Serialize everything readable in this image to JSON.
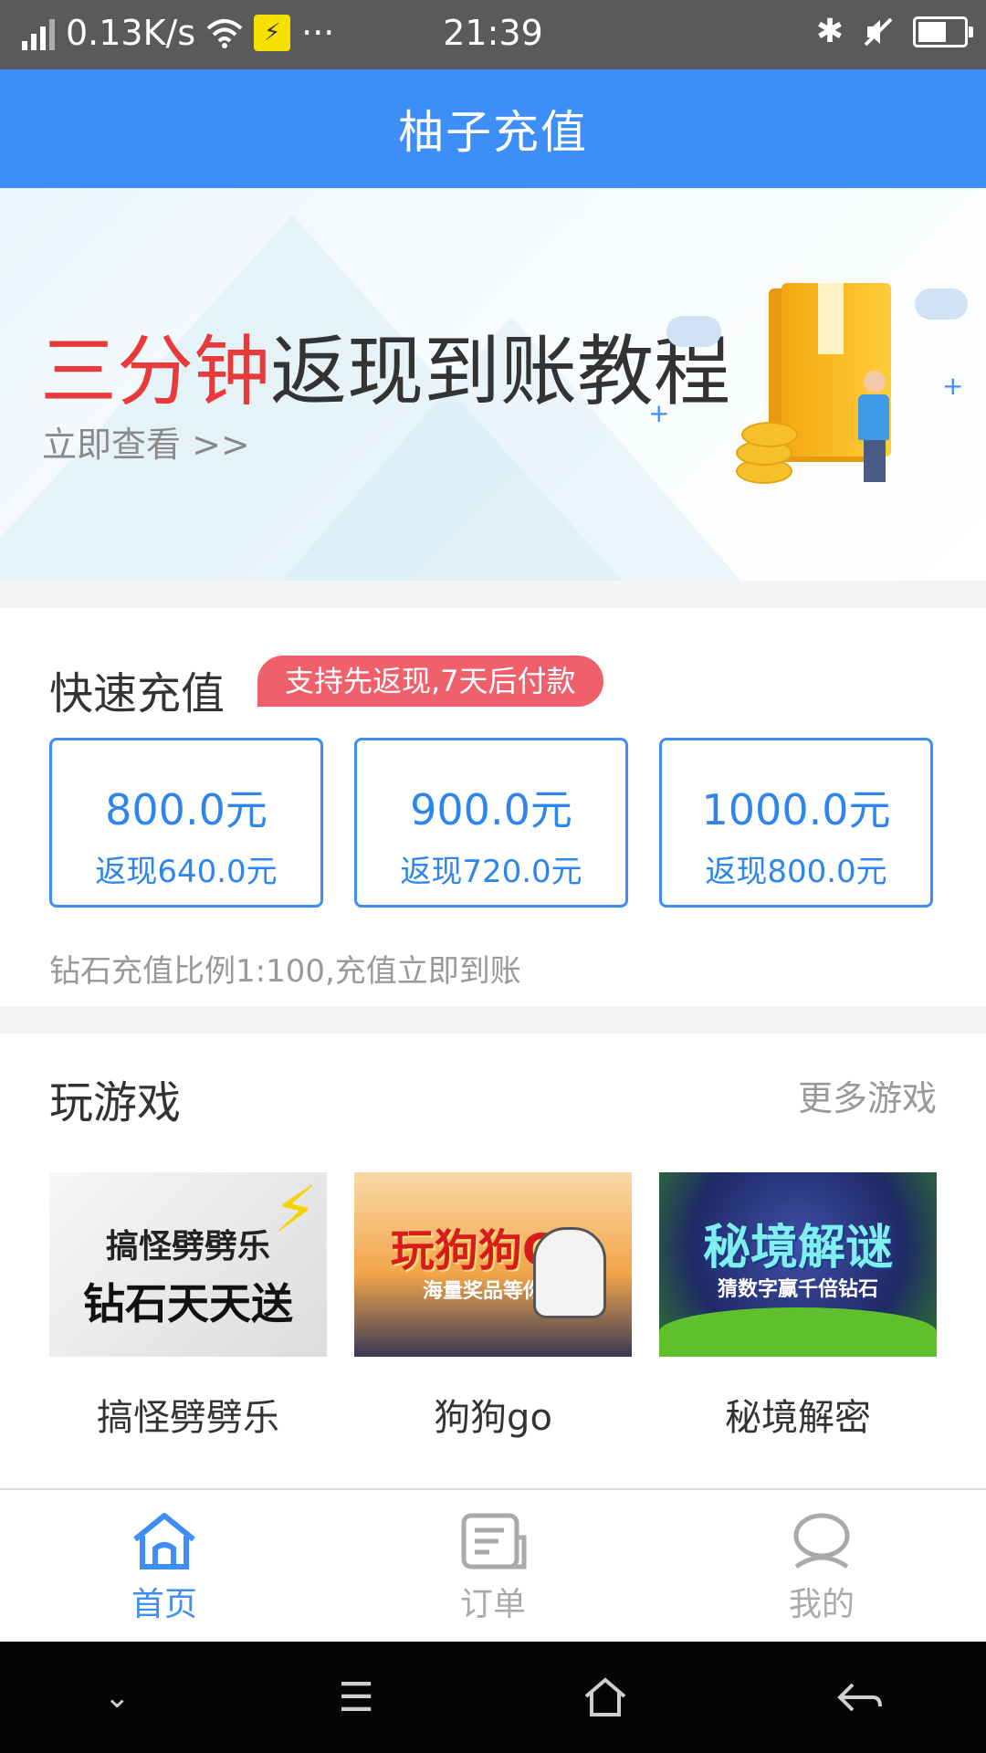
{
  "status_bar": {
    "net_speed": "0.13K/s",
    "dots": "···",
    "time": "21:39"
  },
  "header": {
    "title": "柚子充值"
  },
  "banner": {
    "title_red": "三分钟",
    "title_rest": "返现到账教程",
    "link": "立即查看 >>"
  },
  "quick": {
    "title": "快速充值",
    "badge": "支持先返现,7天后付款",
    "cards": [
      {
        "amount": "800.0元",
        "cashback": "返现640.0元"
      },
      {
        "amount": "900.0元",
        "cashback": "返现720.0元"
      },
      {
        "amount": "1000.0元",
        "cashback": "返现800.0元"
      }
    ],
    "note": "钻石充值比例1:100,充值立即到账"
  },
  "games": {
    "title": "玩游戏",
    "more": "更多游戏",
    "items": [
      {
        "name": "搞怪劈劈乐",
        "image_line1": "搞怪劈劈乐",
        "image_line2": "钻石天天送"
      },
      {
        "name": "狗狗go",
        "image_line1": "玩狗狗GO",
        "image_line2": "海量奖品等你拿"
      },
      {
        "name": "秘境解密",
        "image_line1": "秘境解谜",
        "image_line2": "猜数字赢千倍钻石"
      }
    ]
  },
  "tabs": [
    {
      "label": "首页",
      "icon": "home-icon",
      "active": true
    },
    {
      "label": "订单",
      "icon": "order-icon",
      "active": false
    },
    {
      "label": "我的",
      "icon": "user-icon",
      "active": false
    }
  ],
  "colors": {
    "primary": "#3d8ef7",
    "badge": "#f0606a",
    "accent_red": "#e83a3a"
  }
}
